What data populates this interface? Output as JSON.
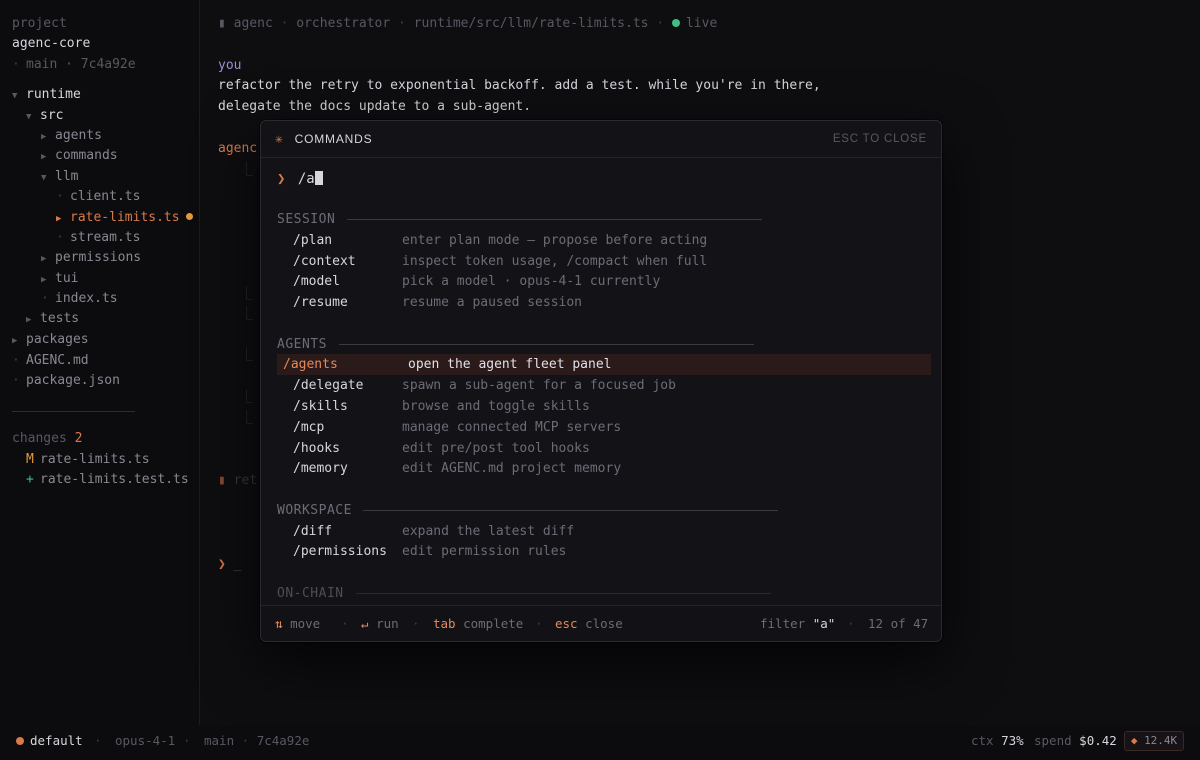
{
  "sidebar": {
    "project_label": "project",
    "project_name": "agenc-core",
    "branch_line": "main · 7c4a92e",
    "tree": [
      {
        "label": "runtime",
        "type": "dir-open"
      },
      {
        "label": "src",
        "type": "dir-open"
      },
      {
        "label": "agents",
        "type": "dir"
      },
      {
        "label": "commands",
        "type": "dir"
      },
      {
        "label": "llm",
        "type": "dir-open"
      },
      {
        "label": "client.ts",
        "type": "file"
      },
      {
        "label": "rate-limits.ts",
        "type": "file-active"
      },
      {
        "label": "stream.ts",
        "type": "file"
      },
      {
        "label": "permissions",
        "type": "dir"
      },
      {
        "label": "tui",
        "type": "dir"
      },
      {
        "label": "index.ts",
        "type": "file"
      },
      {
        "label": "tests",
        "type": "dir"
      },
      {
        "label": "packages",
        "type": "dir"
      },
      {
        "label": "AGENC.md",
        "type": "file"
      },
      {
        "label": "package.json",
        "type": "file"
      }
    ],
    "changes_label": "changes",
    "changes_count": "2",
    "changes": [
      {
        "marker": "M",
        "file": "rate-limits.ts"
      },
      {
        "marker": "+",
        "file": "rate-limits.test.ts"
      }
    ]
  },
  "topbar": {
    "marker": "▮",
    "parts": [
      "agenc",
      "orchestrator",
      "runtime/src/llm/rate-limits.ts"
    ],
    "status": "live"
  },
  "conversation": {
    "speaker": "you",
    "line1": "refactor the retry to exponential backoff. add a test. while you're in there,",
    "line2": "delegate the docs update to a sub-agent.",
    "agent_label": "agenc",
    "peek_ret": "ret",
    "prompt_glyph": "❯",
    "prompt_cursor": "_"
  },
  "palette": {
    "star": "✳",
    "title": "COMMANDS",
    "close_hint": "ESC TO CLOSE",
    "prompt": "❯",
    "query": "/a",
    "sections": [
      {
        "name": "SESSION",
        "items": [
          {
            "cmd": "/plan",
            "desc": "enter plan mode — propose before acting"
          },
          {
            "cmd": "/context",
            "desc": "inspect token usage, /compact when full"
          },
          {
            "cmd": "/model",
            "desc": "pick a model · opus-4-1 currently"
          },
          {
            "cmd": "/resume",
            "desc": "resume a paused session"
          }
        ]
      },
      {
        "name": "AGENTS",
        "items": [
          {
            "cmd": "/agents",
            "desc": "open the agent fleet panel",
            "selected": true
          },
          {
            "cmd": "/delegate",
            "desc": "spawn a sub-agent for a focused job"
          },
          {
            "cmd": "/skills",
            "desc": "browse and toggle skills"
          },
          {
            "cmd": "/mcp",
            "desc": "manage connected MCP servers"
          },
          {
            "cmd": "/hooks",
            "desc": "edit pre/post tool hooks"
          },
          {
            "cmd": "/memory",
            "desc": "edit AGENC.md project memory"
          }
        ]
      },
      {
        "name": "WORKSPACE",
        "items": [
          {
            "cmd": "/diff",
            "desc": "expand the latest diff"
          },
          {
            "cmd": "/permissions",
            "desc": "edit permission rules"
          }
        ]
      },
      {
        "name": "ON-CHAIN",
        "items": []
      }
    ],
    "footer": {
      "move_key": "⇅",
      "move_label": "move",
      "run_key": "↵",
      "run_label": "run",
      "tab_key": "tab",
      "tab_label": "complete",
      "esc_key": "esc",
      "esc_label": "close",
      "filter_label": "filter",
      "filter_value": "\"a\"",
      "count": "12 of 47"
    }
  },
  "statusbar": {
    "mode": "default",
    "model": "opus-4-1",
    "branch": "main",
    "commit": "7c4a92e",
    "ctx_label": "ctx",
    "ctx_value": "73%",
    "spend_label": "spend",
    "spend_value": "$0.42",
    "tokens": "12.4K",
    "token_icon": "◆"
  },
  "colors": {
    "accent": "#d97a4a",
    "live": "#3fbf84",
    "modified": "#e39a3c",
    "background": "#0e0d10"
  }
}
